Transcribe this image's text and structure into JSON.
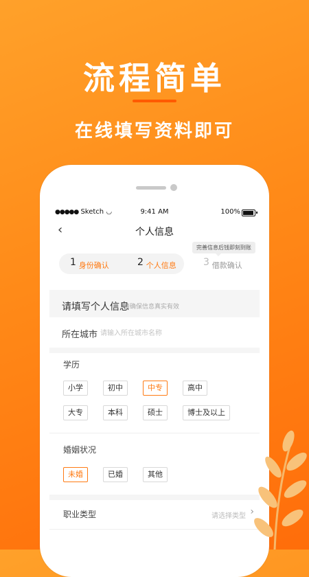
{
  "promo": {
    "headline": "流程简单",
    "subheadline": "在线填写资料即可"
  },
  "status_bar": {
    "signal": "●●●●●",
    "carrier": "Sketch",
    "time": "9:41 AM",
    "battery": "100%"
  },
  "nav": {
    "back_icon": "‹",
    "title": "个人信息"
  },
  "steps": [
    {
      "num": "1",
      "label": "身份确认",
      "state": "done"
    },
    {
      "num": "2",
      "label": "个人信息",
      "state": "current"
    },
    {
      "num": "3",
      "label": "借款确认",
      "state": "pending"
    }
  ],
  "steps_tip": "完善信息后钱即刻到账",
  "section": {
    "title": "请填写个人信息",
    "subtitle": "请确保信息真实有效"
  },
  "city": {
    "label": "所在城市",
    "placeholder": "请输入所在城市名称",
    "value": ""
  },
  "education": {
    "label": "学历",
    "options": [
      "小学",
      "初中",
      "中专",
      "高中",
      "大专",
      "本科",
      "硕士",
      "博士及以上"
    ],
    "selected": "中专"
  },
  "marital": {
    "label": "婚姻状况",
    "options": [
      "未婚",
      "已婚",
      "其他"
    ],
    "selected": "未婚"
  },
  "job": {
    "label": "职业类型",
    "placeholder": "请选择类型",
    "chevron": "›"
  },
  "colors": {
    "accent": "#ff7a12",
    "background_top": "#ffa12a",
    "background_bottom": "#ff6d0a"
  }
}
